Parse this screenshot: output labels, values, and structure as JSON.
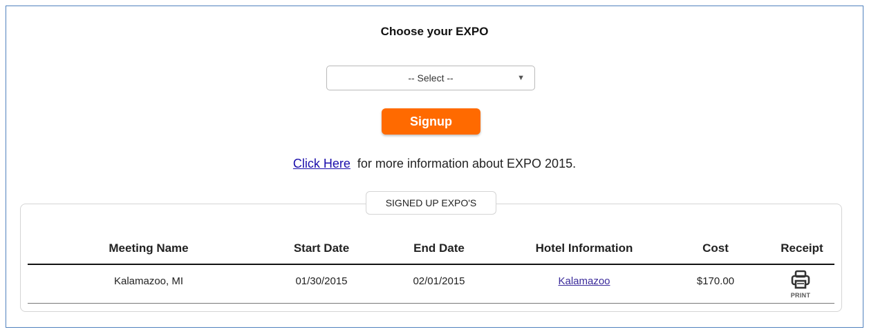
{
  "page": {
    "title": "Choose your EXPO"
  },
  "expo_select": {
    "selected": "-- Select --"
  },
  "signup_button": {
    "label": "Signup"
  },
  "info": {
    "link_text": "Click Here",
    "text": "for more information about EXPO 2015."
  },
  "signed_up": {
    "legend": "SIGNED UP EXPO'S",
    "columns": [
      "Meeting Name",
      "Start Date",
      "End Date",
      "Hotel Information",
      "Cost",
      "Receipt"
    ],
    "rows": [
      {
        "meeting_name": "Kalamazoo, MI",
        "start_date": "01/30/2015",
        "end_date": "02/01/2015",
        "hotel": "Kalamazoo",
        "cost": "$170.00",
        "receipt_icon": "printer-icon",
        "receipt_label": "PRINT"
      }
    ]
  },
  "colors": {
    "frame_border": "#4f81bd",
    "signup_button": "#ff6a00",
    "link": "#1a0dab"
  }
}
